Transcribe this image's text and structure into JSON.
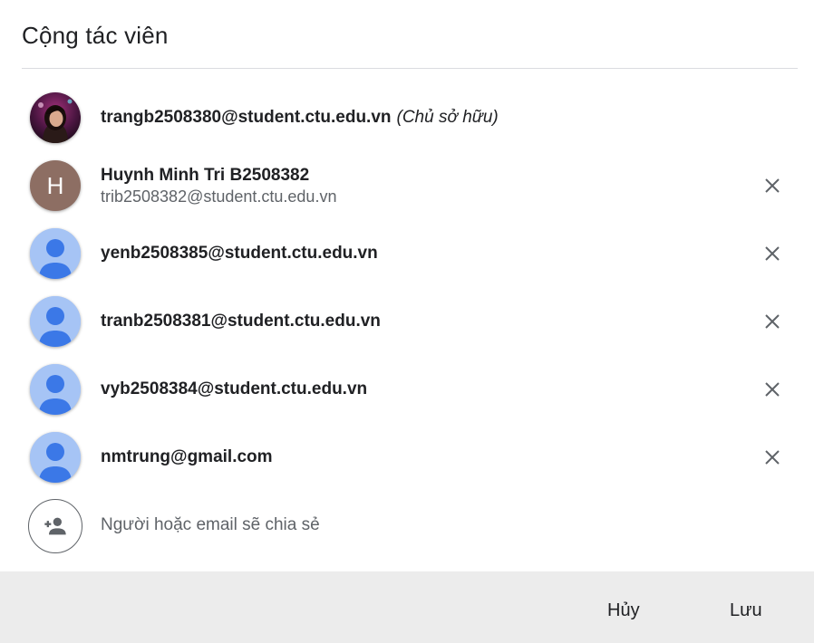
{
  "dialog": {
    "title": "Cộng tác viên"
  },
  "collaborators": [
    {
      "email": "trangb2508380@student.ctu.edu.vn",
      "role": "(Chủ sở hữu)",
      "avatar": "photo"
    },
    {
      "name": "Huynh Minh Tri B2508382",
      "email": "trib2508382@student.ctu.edu.vn",
      "avatar_letter": "H",
      "avatar_color": "#8d6e63"
    },
    {
      "email": "yenb2508385@student.ctu.edu.vn",
      "avatar": "person-icon"
    },
    {
      "email": "tranb2508381@student.ctu.edu.vn",
      "avatar": "person-icon"
    },
    {
      "email": "vyb2508384@student.ctu.edu.vn",
      "avatar": "person-icon"
    },
    {
      "email": "nmtrung@gmail.com",
      "avatar": "person-icon"
    }
  ],
  "add_collaborator": {
    "placeholder": "Người hoặc email sẽ chia sẻ",
    "icon": "person-add-icon"
  },
  "footer": {
    "cancel_label": "Hủy",
    "save_label": "Lưu"
  },
  "colors": {
    "default_avatar": "#a6c4f5",
    "default_avatar_figure": "#3b78e7",
    "footer_bg": "#ececec"
  }
}
